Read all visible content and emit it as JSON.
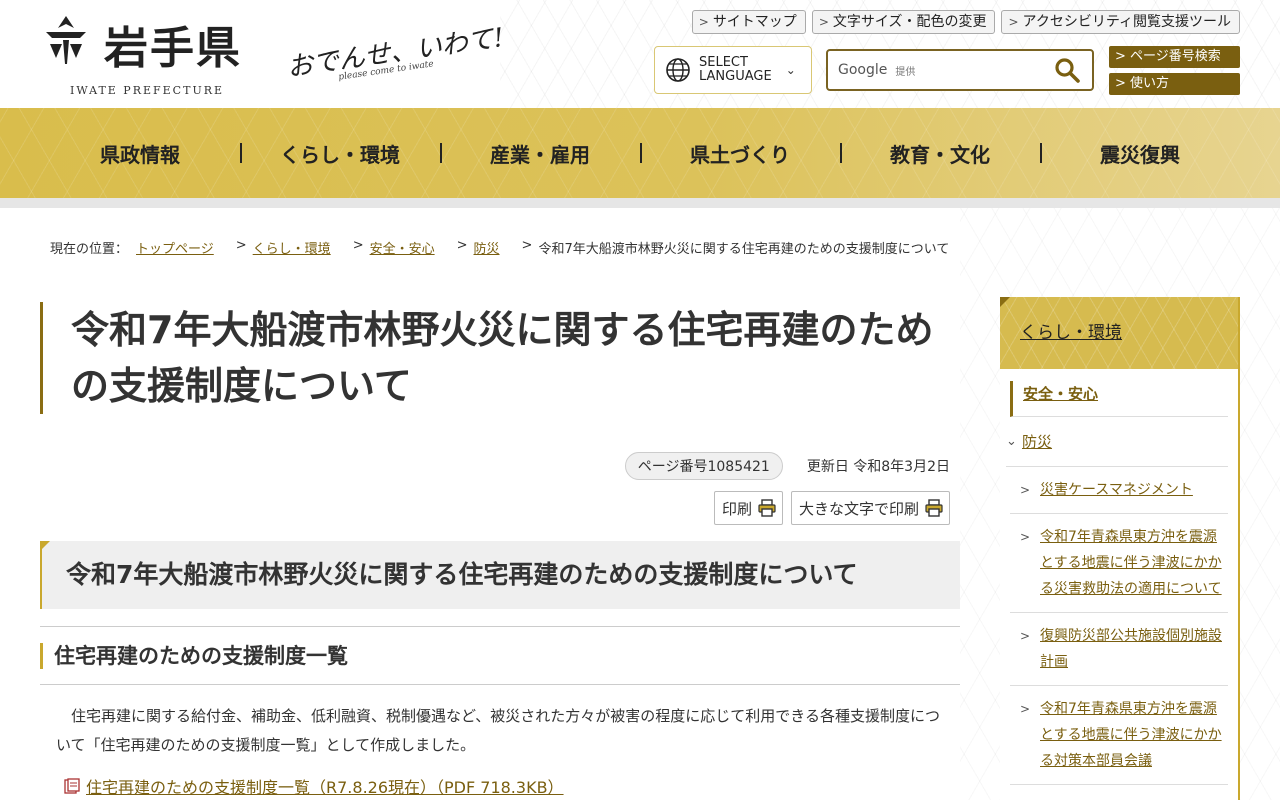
{
  "header": {
    "logo_text": "岩手県",
    "logo_sub": "IWATE PREFECTURE",
    "catch_main": "おでんせ、いわて!",
    "catch_sub": "please come to iwate",
    "util_links": [
      "サイトマップ",
      "文字サイズ・配色の変更",
      "アクセシビリティ閲覧支援ツール"
    ],
    "language_line1": "SELECT",
    "language_line2": "LANGUAGE",
    "search_google": "Google",
    "search_provided": "提供",
    "side_buttons": [
      "ページ番号検索",
      "使い方"
    ]
  },
  "gnav": [
    "県政情報",
    "くらし・環境",
    "産業・雇用",
    "県土づくり",
    "教育・文化",
    "震災復興"
  ],
  "breadcrumb": {
    "label": "現在の位置：",
    "links": [
      "トップページ",
      "くらし・環境",
      "安全・安心",
      "防災"
    ],
    "current": "令和7年大船渡市林野火災に関する住宅再建のための支援制度について"
  },
  "main": {
    "title": "令和7年大船渡市林野火災に関する住宅再建のための支援制度について",
    "page_no": "ページ番号1085421",
    "updated": "更新日 令和8年3月2日",
    "print": "印刷",
    "print_large": "大きな文字で印刷",
    "h2": "令和7年大船渡市林野火災に関する住宅再建のための支援制度について",
    "h3": "住宅再建のための支援制度一覧",
    "body": "住宅再建に関する給付金、補助金、低利融資、税制優遇など、被災された方々が被害の程度に応じて利用できる各種支援制度について「住宅再建のための支援制度一覧」として作成しました。",
    "pdf_link": "住宅再建のための支援制度一覧（R7.8.26現在）（PDF 718.3KB）"
  },
  "sidebar": {
    "head": "くらし・環境",
    "item1": "安全・安心",
    "item2": "防災",
    "sub_items": [
      "災害ケースマネジメント",
      "令和7年青森県東方沖を震源とする地震に伴う津波にかかる災害救助法の適用について",
      "復興防災部公共施設個別施設計画",
      "令和7年青森県東方沖を震源とする地震に伴う津波にかかる対策本部員会議"
    ]
  },
  "colors": {
    "gold": "#d6bb4f",
    "brown": "#7a5f10"
  }
}
